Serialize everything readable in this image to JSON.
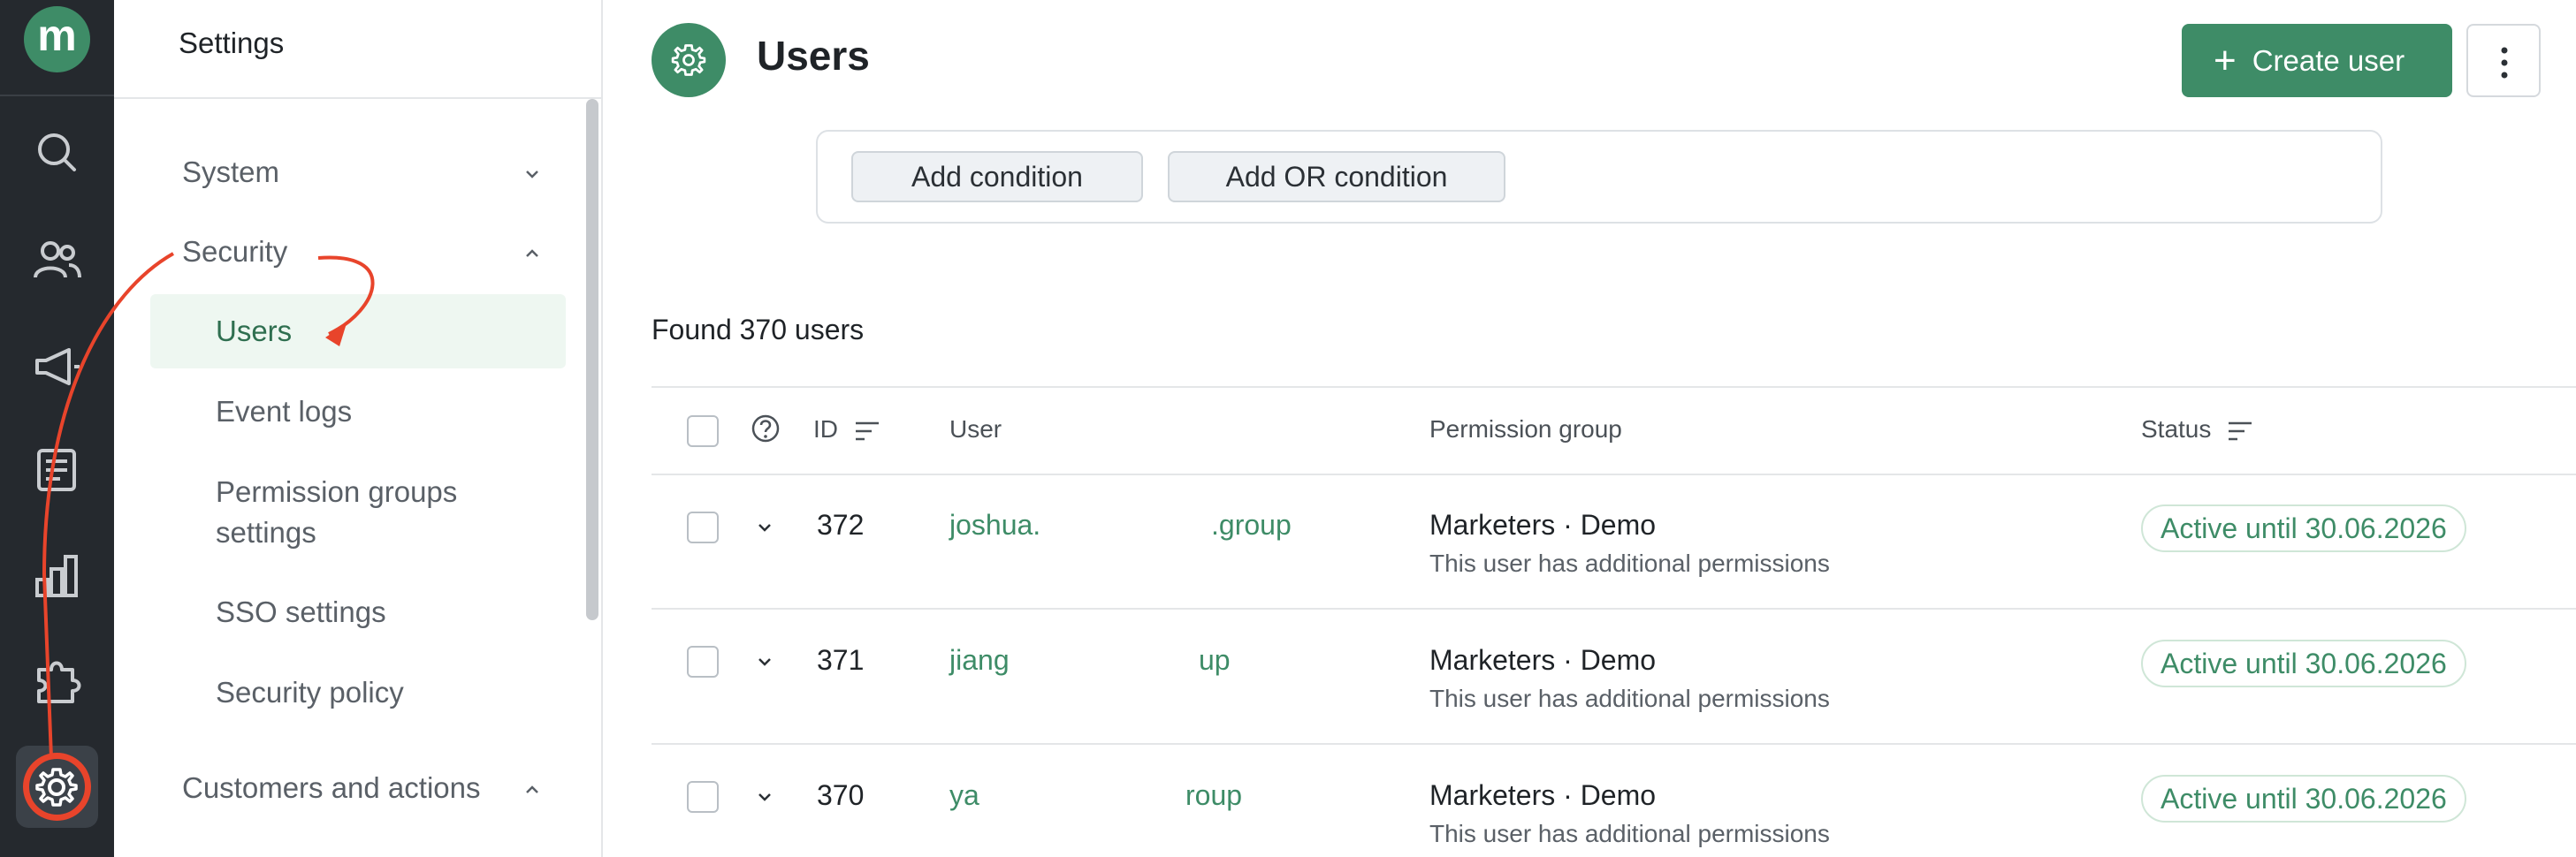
{
  "brand": {
    "logo_letter": "m",
    "accent_color": "#3e8c67",
    "annotation_color": "#e8442b"
  },
  "rail": {
    "icons": [
      "search-icon",
      "users-icon",
      "megaphone-icon",
      "feed-icon",
      "chart-icon",
      "puzzle-icon",
      "gear-icon"
    ]
  },
  "sidebar": {
    "title": "Settings",
    "groups": [
      {
        "label": "System",
        "expanded": false
      },
      {
        "label": "Security",
        "expanded": true,
        "items": [
          "Users",
          "Event logs",
          "Permission groups settings",
          "SSO settings",
          "Security policy"
        ],
        "selected": "Users"
      },
      {
        "label": "Customers and actions",
        "expanded": true
      }
    ],
    "items": {
      "users": "Users",
      "event_logs": "Event logs",
      "perm_line1": "Permission groups",
      "perm_line2": "settings",
      "sso": "SSO settings",
      "policy": "Security policy"
    }
  },
  "header": {
    "title": "Users",
    "create_label": "Create user"
  },
  "filters": {
    "add_condition": "Add condition",
    "add_or_condition": "Add OR condition"
  },
  "results": {
    "found_text": "Found 370 users"
  },
  "table": {
    "columns": {
      "id": "ID",
      "user": "User",
      "permission": "Permission group",
      "status": "Status"
    },
    "rows": [
      {
        "id": "372",
        "user_a": "joshua.",
        "user_b": ".group",
        "permission": "Marketers · Demo",
        "permission_note": "This user has additional permissions",
        "status": "Active until 30.06.2026"
      },
      {
        "id": "371",
        "user_a": "jiang",
        "user_b": "up",
        "permission": "Marketers · Demo",
        "permission_note": "This user has additional permissions",
        "status": "Active until 30.06.2026"
      },
      {
        "id": "370",
        "user_a": "ya",
        "user_b": "roup",
        "permission": "Marketers · Demo",
        "permission_note": "This user has additional permissions",
        "status": "Active until 30.06.2026"
      }
    ]
  }
}
